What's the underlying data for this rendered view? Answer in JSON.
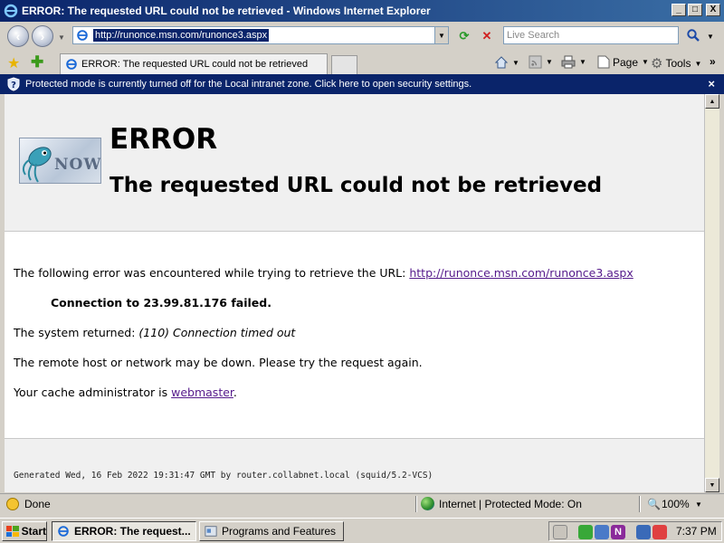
{
  "window": {
    "title": "ERROR: The requested URL could not be retrieved - Windows Internet Explorer",
    "minimize": "_",
    "maximize": "□",
    "close": "X"
  },
  "address_bar": {
    "url": "http://runonce.msn.com/runonce3.aspx",
    "search_placeholder": "Live Search"
  },
  "tab": {
    "label": "ERROR: The requested URL could not be retrieved"
  },
  "command_bar": {
    "page": "Page",
    "tools": "Tools"
  },
  "info_bar": {
    "message": "Protected mode is currently turned off for the Local intranet zone.  Click here to open security settings.",
    "close": "×"
  },
  "page": {
    "logo_text": "NOW",
    "heading": "ERROR",
    "subheading": "The requested URL could not be retrieved",
    "error_intro": "The following error was encountered while trying to retrieve the URL: ",
    "error_url": "http://runonce.msn.com/runonce3.aspx",
    "connection_failed": "Connection to 23.99.81.176 failed.",
    "system_returned_label": "The system returned: ",
    "system_returned_value": "(110) Connection timed out",
    "remote_host_msg": "The remote host or network may be down. Please try the request again.",
    "cache_admin_label": "Your cache administrator is ",
    "cache_admin_link": "webmaster",
    "cache_admin_end": ".",
    "footer": "Generated Wed, 16 Feb 2022 19:31:47 GMT by router.collabnet.local (squid/5.2-VCS)"
  },
  "status_bar": {
    "status": "Done",
    "zone": "Internet | Protected Mode: On",
    "zoom": "100%"
  },
  "taskbar": {
    "start": "Start",
    "tasks": [
      {
        "label": "ERROR: The request...",
        "active": true
      },
      {
        "label": "Programs and Features",
        "active": false
      }
    ],
    "clock": "7:37 PM"
  }
}
